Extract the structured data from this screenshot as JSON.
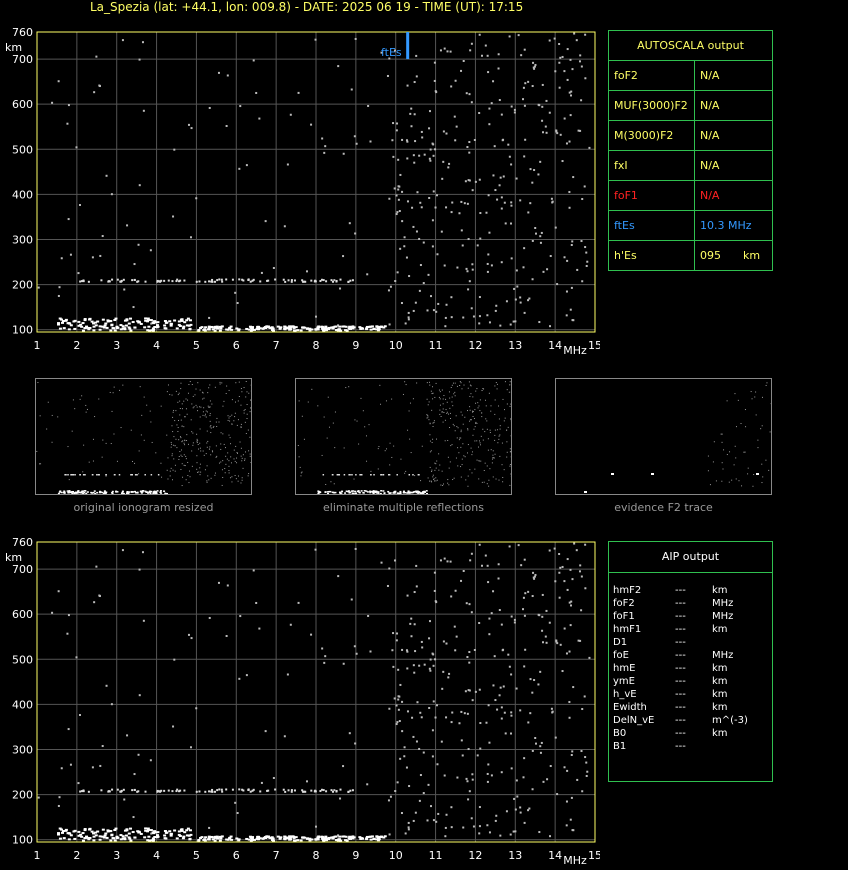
{
  "header": {
    "title": "La_Spezia (lat: +44.1, lon: 009.8) - DATE:  2025 06 19 - TIME (UT): 17:15"
  },
  "chart_data": [
    {
      "type": "scatter",
      "xlabel": "MHz",
      "ylabel": "km",
      "xlim": [
        1,
        15
      ],
      "ylim": [
        95,
        760
      ],
      "xticks": [
        "1",
        "2",
        "3",
        "4",
        "5",
        "6",
        "7",
        "8",
        "9",
        "10",
        "11",
        "12",
        "13",
        "14",
        "15"
      ],
      "yticks": [
        "100",
        "200",
        "300",
        "400",
        "500",
        "600",
        "700",
        "760"
      ],
      "annotation": {
        "label": "ftEs",
        "x": 10.3,
        "ymin": 700,
        "ymax": 760,
        "color": "#3399ff"
      },
      "grid": true
    },
    {
      "type": "scatter",
      "xlabel": "MHz",
      "ylabel": "km",
      "xlim": [
        1,
        15
      ],
      "ylim": [
        95,
        760
      ],
      "xticks": [
        "1",
        "2",
        "3",
        "4",
        "5",
        "6",
        "7",
        "8",
        "9",
        "10",
        "11",
        "12",
        "13",
        "14",
        "15"
      ],
      "yticks": [
        "100",
        "200",
        "300",
        "400",
        "500",
        "600",
        "700",
        "760"
      ],
      "grid": true
    }
  ],
  "autoscala": {
    "title": "AUTOSCALA output",
    "rows": [
      {
        "label": "foF2",
        "value": "N/A",
        "color": "yellow"
      },
      {
        "label": "MUF(3000)F2",
        "value": "N/A",
        "color": "yellow"
      },
      {
        "label": "M(3000)F2",
        "value": "N/A",
        "color": "yellow"
      },
      {
        "label": "fxI",
        "value": "N/A",
        "color": "yellow"
      },
      {
        "label": "foF1",
        "value": "N/A",
        "color": "red"
      },
      {
        "label": "ftEs",
        "value": "10.3 MHz",
        "color": "blue"
      }
    ],
    "hEs": {
      "label": "h'Es",
      "value": "095",
      "unit": "km"
    }
  },
  "thumbnails": [
    {
      "caption": "original ionogram resized"
    },
    {
      "caption": "eliminate multiple reflections"
    },
    {
      "caption": "evidence F2 trace"
    }
  ],
  "aip": {
    "title": "AIP output",
    "rows": [
      {
        "name": "hmF2",
        "val": "---",
        "unit": "km"
      },
      {
        "name": "foF2",
        "val": "---",
        "unit": "MHz"
      },
      {
        "name": "foF1",
        "val": "---",
        "unit": "MHz"
      },
      {
        "name": "hmF1",
        "val": "---",
        "unit": "km"
      },
      {
        "name": "D1",
        "val": "---",
        "unit": ""
      },
      {
        "name": "foE",
        "val": "---",
        "unit": "MHz"
      },
      {
        "name": "hmE",
        "val": "---",
        "unit": "km"
      },
      {
        "name": "ymE",
        "val": "---",
        "unit": "km"
      },
      {
        "name": "h_vE",
        "val": "---",
        "unit": "km"
      },
      {
        "name": "Ewidth",
        "val": "---",
        "unit": "km"
      },
      {
        "name": "DelN_vE",
        "val": "---",
        "unit": "m^(-3)"
      },
      {
        "name": "B0",
        "val": "---",
        "unit": "km"
      },
      {
        "name": "B1",
        "val": "---",
        "unit": ""
      }
    ]
  }
}
